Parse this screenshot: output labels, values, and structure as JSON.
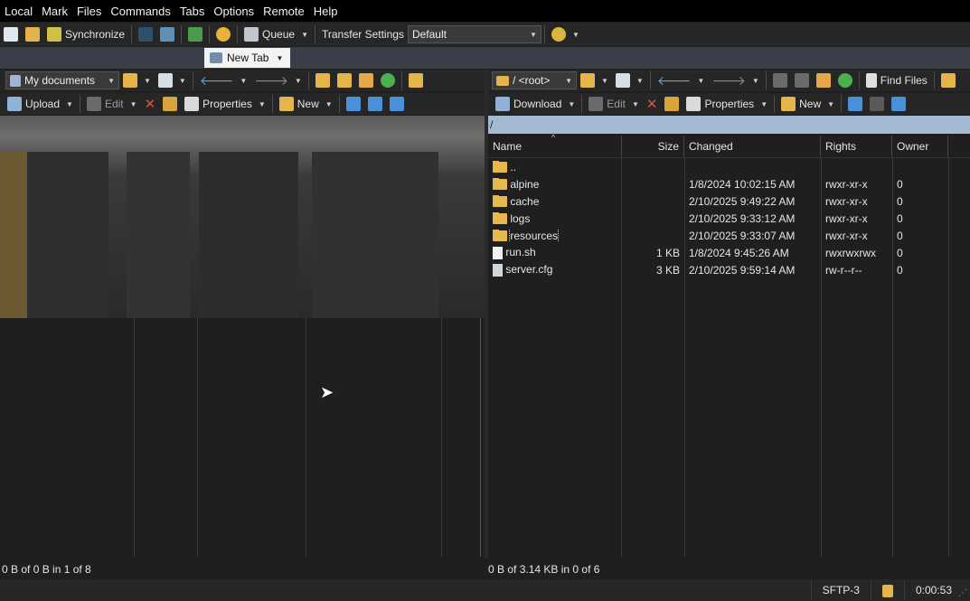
{
  "menu": [
    "Local",
    "Mark",
    "Files",
    "Commands",
    "Tabs",
    "Options",
    "Remote",
    "Help"
  ],
  "toolbar": {
    "synchronize_label": "Synchronize",
    "queue_label": "Queue",
    "transfer_settings_label": "Transfer Settings",
    "transfer_settings_value": "Default"
  },
  "tab": {
    "label": "New Tab"
  },
  "local": {
    "location": "My documents",
    "upload_label": "Upload",
    "edit_label": "Edit",
    "properties_label": "Properties",
    "new_label": "New",
    "status": "0 B of 0 B in 1 of 8"
  },
  "remote": {
    "location": "/ <root>",
    "find_files_label": "Find Files",
    "download_label": "Download",
    "edit_label": "Edit",
    "properties_label": "Properties",
    "new_label": "New",
    "path": "/",
    "columns": [
      "Name",
      "Size",
      "Changed",
      "Rights",
      "Owner"
    ],
    "files": [
      {
        "name": "..",
        "size": "",
        "changed": "",
        "rights": "",
        "owner": "",
        "type": "parent"
      },
      {
        "name": "alpine",
        "size": "",
        "changed": "1/8/2024 10:02:15 AM",
        "rights": "rwxr-xr-x",
        "owner": "0",
        "type": "folder"
      },
      {
        "name": "cache",
        "size": "",
        "changed": "2/10/2025 9:49:22 AM",
        "rights": "rwxr-xr-x",
        "owner": "0",
        "type": "folder"
      },
      {
        "name": "logs",
        "size": "",
        "changed": "2/10/2025 9:33:12 AM",
        "rights": "rwxr-xr-x",
        "owner": "0",
        "type": "folder"
      },
      {
        "name": "resources",
        "size": "",
        "changed": "2/10/2025 9:33:07 AM",
        "rights": "rwxr-xr-x",
        "owner": "0",
        "type": "folder"
      },
      {
        "name": "run.sh",
        "size": "1 KB",
        "changed": "1/8/2024 9:45:26 AM",
        "rights": "rwxrwxrwx",
        "owner": "0",
        "type": "file"
      },
      {
        "name": "server.cfg",
        "size": "3 KB",
        "changed": "2/10/2025 9:59:14 AM",
        "rights": "rw-r--r--",
        "owner": "0",
        "type": "config"
      }
    ],
    "status": "0 B of 3.14 KB in 0 of 6"
  },
  "statusbar": {
    "protocol": "SFTP-3",
    "elapsed": "0:00:53"
  }
}
